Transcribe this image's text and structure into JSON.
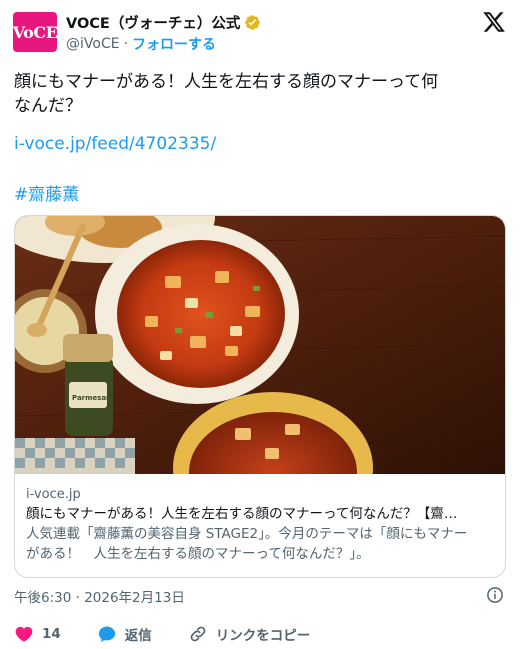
{
  "account": {
    "avatar_text": "VoCE",
    "display_name": "VOCE（ヴォーチェ）公式",
    "handle": "@iVoCE",
    "separator": "·",
    "follow_label": "フォローする"
  },
  "tweet": {
    "text_line1": "顔にもマナーがある！人生を左右する顔のマナーって何",
    "text_line2": "なんだ？",
    "link": "i-voce.jp/feed/4702335/",
    "hashtag": "#齋藤薫"
  },
  "card": {
    "domain": "i-voce.jp",
    "title": "顔にもマナーがある！人生を左右する顔のマナーって何なんだ？【齋…",
    "desc_line1": "人気連載「齋藤薫の美容自身 STAGE2」。今月のテーマは「顔にもマナー",
    "desc_line2": "がある！　人生を左右する顔のマナーって何なんだ？」。",
    "jar_label": "Parmesan"
  },
  "timestamp": "午後6:30 · 2026年2月13日",
  "actions": {
    "like_count": "14",
    "reply_label": "返信",
    "copy_link_label": "リンクをコピー"
  },
  "colors": {
    "brand": "#e8177f",
    "link": "#1d9bf0",
    "like": "#f91880",
    "muted": "#536471"
  }
}
